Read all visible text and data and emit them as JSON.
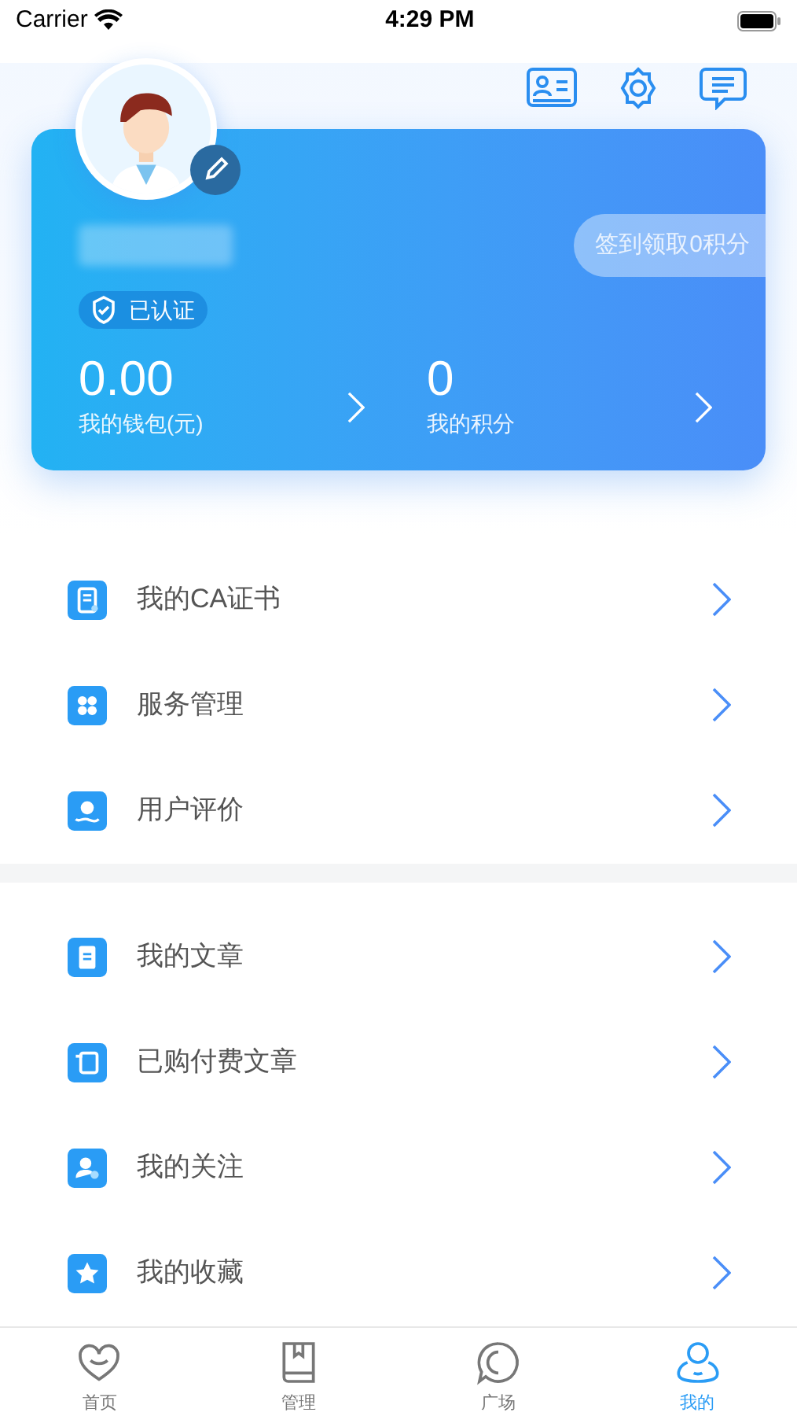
{
  "status_bar": {
    "carrier": "Carrier",
    "time": "4:29 PM"
  },
  "profile": {
    "verified_badge": "已认证",
    "checkin_button": "签到领取0积分"
  },
  "stats": [
    {
      "value": "0.00",
      "label": "我的钱包(元)"
    },
    {
      "value": "0",
      "label": "我的积分"
    }
  ],
  "menu_groups": [
    [
      {
        "label": "我的CA证书"
      },
      {
        "label": "服务管理"
      },
      {
        "label": "用户评价"
      }
    ],
    [
      {
        "label": "我的文章"
      },
      {
        "label": "已购付费文章"
      },
      {
        "label": "我的关注"
      },
      {
        "label": "我的收藏"
      }
    ]
  ],
  "tabs": [
    {
      "label": "首页",
      "selected": false
    },
    {
      "label": "管理",
      "selected": false
    },
    {
      "label": "广场",
      "selected": false
    },
    {
      "label": "我的",
      "selected": true
    }
  ]
}
